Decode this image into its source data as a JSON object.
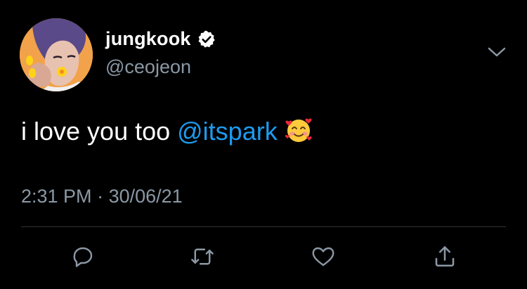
{
  "tweet": {
    "display_name": "jungkook",
    "handle": "@ceojeon",
    "text_before": "i love you too ",
    "mention": "@itspark",
    "emoji_name": "smiling-face-with-hearts-emoji",
    "time": "2:31 PM",
    "separator": " · ",
    "date": "30/06/21"
  },
  "icons": {
    "verified": "verified-badge-icon",
    "caret": "chevron-down-icon",
    "reply": "reply-icon",
    "retweet": "retweet-icon",
    "like": "heart-icon",
    "share": "share-icon"
  },
  "colors": {
    "background": "#000000",
    "text": "#ffffff",
    "secondary": "#8b98a5",
    "link": "#1d9bf0",
    "divider": "#2f3336"
  }
}
